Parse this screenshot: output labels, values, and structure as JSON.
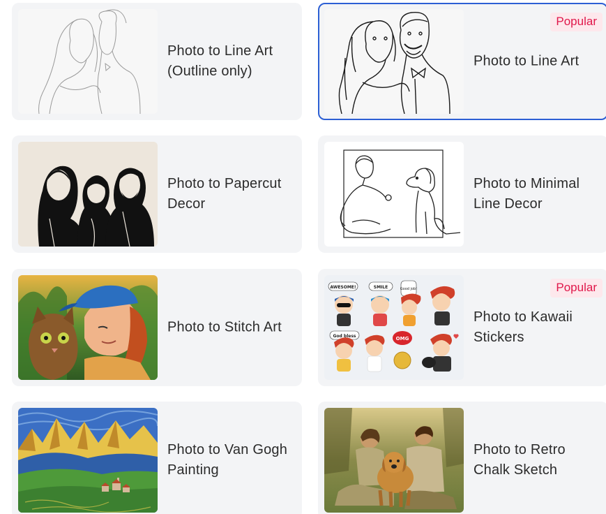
{
  "cards": [
    {
      "title": "Photo to Line Art (Outline only)",
      "thumbnail": "line-art-outline-couple",
      "selected": false
    },
    {
      "title": "Photo to Line Art",
      "thumbnail": "line-art-couple",
      "badge": "Popular",
      "selected": true
    },
    {
      "title": "Photo to Papercut Decor",
      "thumbnail": "papercut-family",
      "selected": false
    },
    {
      "title": "Photo to Minimal Line Decor",
      "thumbnail": "minimal-line-man-dog",
      "selected": false
    },
    {
      "title": "Photo to Stitch Art",
      "thumbnail": "stitch-art-boy-cat",
      "selected": false
    },
    {
      "title": "Photo to Kawaii Stickers",
      "thumbnail": "kawaii-stickers",
      "badge": "Popular",
      "selected": false
    },
    {
      "title": "Photo to Van Gogh Painting",
      "thumbnail": "van-gogh-landscape",
      "selected": false
    },
    {
      "title": "Photo to Retro Chalk Sketch",
      "thumbnail": "retro-chalk-couple-dog",
      "selected": false
    }
  ],
  "stickers": {
    "awesome": "AWESOME!",
    "smile": "SMILE",
    "good_job": "Good job!",
    "god_bless": "God bless",
    "omg": "OMG"
  },
  "colors": {
    "card_bg": "#f3f4f6",
    "selected_border": "#2c5fd4",
    "badge_bg": "#fde8ec",
    "badge_text": "#e0174a",
    "title_text": "#2b2b2b"
  }
}
